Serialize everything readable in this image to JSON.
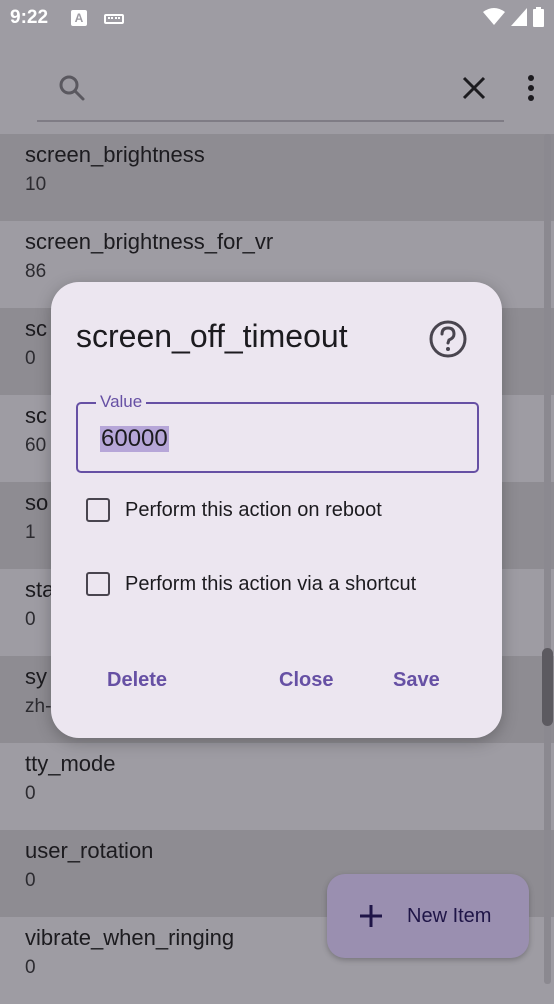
{
  "status_bar": {
    "time": "9:22",
    "a_badge": "A"
  },
  "search": {
    "placeholder": ""
  },
  "list": {
    "rows": [
      {
        "name": "screen_brightness",
        "value": "10"
      },
      {
        "name": "screen_brightness_for_vr",
        "value": "86"
      },
      {
        "name": "sc",
        "value": "0"
      },
      {
        "name": "sc",
        "value": "60"
      },
      {
        "name": "so",
        "value": "1"
      },
      {
        "name": "sta",
        "value": "0"
      },
      {
        "name": "sy",
        "value": "zh-"
      },
      {
        "name": "tty_mode",
        "value": "0"
      },
      {
        "name": "user_rotation",
        "value": "0"
      },
      {
        "name": "vibrate_when_ringing",
        "value": "0"
      }
    ]
  },
  "fab": {
    "label": "New Item"
  },
  "dialog": {
    "title": "screen_off_timeout",
    "field_label": "Value",
    "field_value": "60000",
    "checkbox_reboot": "Perform this action on reboot",
    "checkbox_shortcut": "Perform this action via a shortcut",
    "delete_label": "Delete",
    "close_label": "Close",
    "save_label": "Save"
  },
  "colors": {
    "accent": "#6650a4",
    "dialog_bg": "#ece6f0",
    "scrim_bg": "#9e9ca3"
  }
}
